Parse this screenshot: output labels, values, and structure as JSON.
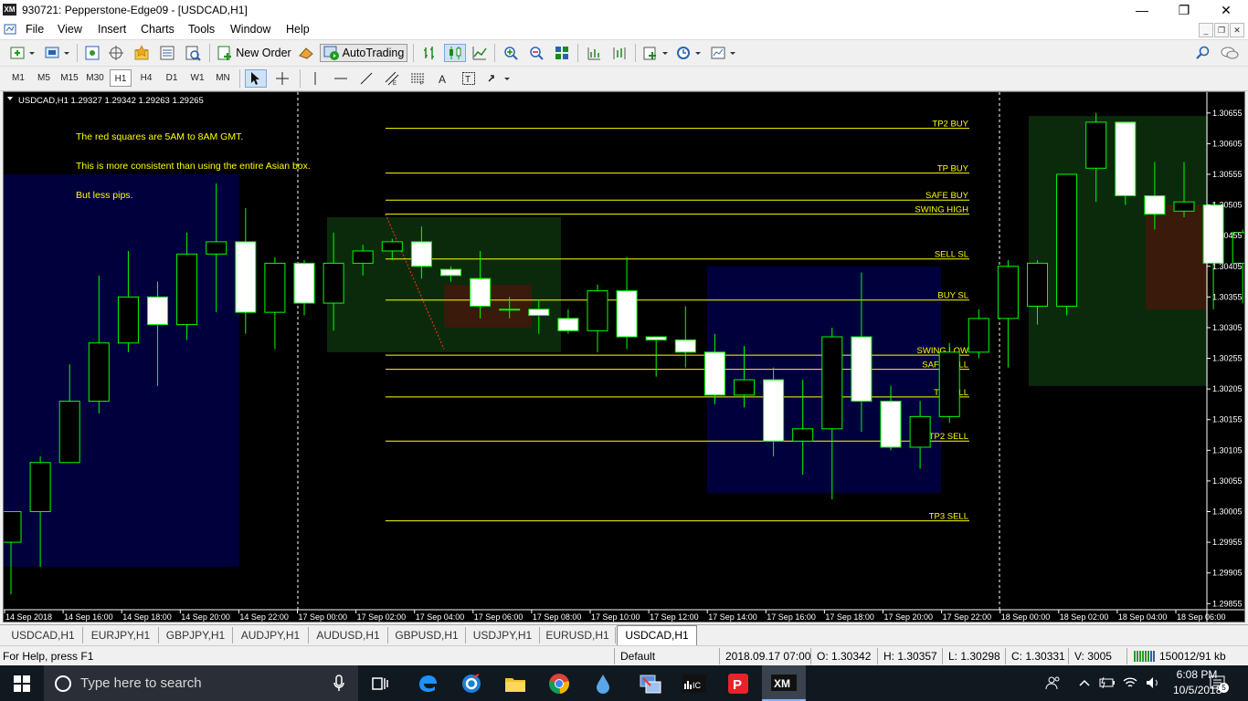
{
  "window": {
    "title": "930721: Pepperstone-Edge09 - [USDCAD,H1]",
    "app_logo": "XM",
    "minimize": "—",
    "maximize": "❐",
    "close": "✕"
  },
  "menu": [
    "File",
    "View",
    "Insert",
    "Charts",
    "Tools",
    "Window",
    "Help"
  ],
  "toolbar": {
    "new_order": "New Order",
    "autotrading": "AutoTrading"
  },
  "timeframes": [
    "M1",
    "M5",
    "M15",
    "M30",
    "H1",
    "H4",
    "D1",
    "W1",
    "MN"
  ],
  "active_timeframe": "H1",
  "chart": {
    "header": "USDCAD,H1  1.29327 1.29342 1.29263 1.29265",
    "annotations": [
      "The red squares are 5AM to 8AM GMT.",
      "This is more consistent than using the entire Asian box.",
      "But less pips."
    ],
    "level_labels": {
      "tp2_buy": "TP2 BUY",
      "tp_buy": "TP BUY",
      "safe_buy": "SAFE BUY",
      "swing_high": "SWING HIGH",
      "sell_sl": "SELL SL",
      "buy_sl": "BUY SL",
      "swing_low": "SWING LOW",
      "safe_sell": "SAFE SELL",
      "tp_sell": "TP SELL",
      "tp2_sell": "TP2 SELL",
      "tp3_sell": "TP3 SELL"
    },
    "price_ticks": [
      "1.30655",
      "1.30605",
      "1.30555",
      "1.30505",
      "1.30455",
      "1.30405",
      "1.30355",
      "1.30305",
      "1.30255",
      "1.30205",
      "1.30155",
      "1.30105",
      "1.30055",
      "1.30005",
      "1.29955",
      "1.29905",
      "1.29855"
    ],
    "time_ticks": [
      "14 Sep 2018",
      "14 Sep 16:00",
      "14 Sep 18:00",
      "14 Sep 20:00",
      "14 Sep 22:00",
      "17 Sep 00:00",
      "17 Sep 02:00",
      "17 Sep 04:00",
      "17 Sep 06:00",
      "17 Sep 08:00",
      "17 Sep 10:00",
      "17 Sep 12:00",
      "17 Sep 14:00",
      "17 Sep 16:00",
      "17 Sep 18:00",
      "17 Sep 20:00",
      "17 Sep 22:00",
      "18 Sep 00:00",
      "18 Sep 02:00",
      "18 Sep 04:00",
      "18 Sep 06:00"
    ],
    "colors": {
      "background": "#000000",
      "bull_body": "#000000",
      "bear_body": "#ffffff",
      "wick": "#00ff00",
      "level_line": "#ffff00",
      "asian_box": "#00003c",
      "green_box": "#0b2a0b",
      "red_box": "#3a1a0a"
    }
  },
  "chart_data": {
    "type": "candlestick",
    "symbol": "USDCAD",
    "timeframe": "H1",
    "ylim": [
      1.29845,
      1.3068
    ],
    "candles": [
      {
        "o": 1.29955,
        "h": 1.30005,
        "l": 1.2987,
        "c": 1.30005
      },
      {
        "o": 1.30005,
        "h": 1.30095,
        "l": 1.29915,
        "c": 1.30085
      },
      {
        "o": 1.30085,
        "h": 1.30245,
        "l": 1.3015,
        "c": 1.30185
      },
      {
        "o": 1.30185,
        "h": 1.3039,
        "l": 1.30165,
        "c": 1.3028
      },
      {
        "o": 1.3028,
        "h": 1.3043,
        "l": 1.30265,
        "c": 1.30355
      },
      {
        "o": 1.30355,
        "h": 1.3038,
        "l": 1.3021,
        "c": 1.3031
      },
      {
        "o": 1.3031,
        "h": 1.3046,
        "l": 1.30285,
        "c": 1.30425
      },
      {
        "o": 1.30425,
        "h": 1.3054,
        "l": 1.3033,
        "c": 1.30445
      },
      {
        "o": 1.30445,
        "h": 1.305,
        "l": 1.30295,
        "c": 1.3033
      },
      {
        "o": 1.3033,
        "h": 1.3042,
        "l": 1.3027,
        "c": 1.3041
      },
      {
        "o": 1.3041,
        "h": 1.30415,
        "l": 1.30325,
        "c": 1.30345
      },
      {
        "o": 1.30345,
        "h": 1.3046,
        "l": 1.303,
        "c": 1.3041
      },
      {
        "o": 1.3041,
        "h": 1.3044,
        "l": 1.3039,
        "c": 1.3043
      },
      {
        "o": 1.3043,
        "h": 1.3045,
        "l": 1.30415,
        "c": 1.30445
      },
      {
        "o": 1.30445,
        "h": 1.3047,
        "l": 1.30385,
        "c": 1.30405
      },
      {
        "o": 1.304,
        "h": 1.30405,
        "l": 1.3038,
        "c": 1.3039
      },
      {
        "o": 1.30385,
        "h": 1.3043,
        "l": 1.3032,
        "c": 1.3034
      },
      {
        "o": 1.30335,
        "h": 1.30355,
        "l": 1.3032,
        "c": 1.30335
      },
      {
        "o": 1.30335,
        "h": 1.3035,
        "l": 1.30295,
        "c": 1.30325
      },
      {
        "o": 1.3032,
        "h": 1.30335,
        "l": 1.30295,
        "c": 1.303
      },
      {
        "o": 1.303,
        "h": 1.30375,
        "l": 1.30265,
        "c": 1.30365
      },
      {
        "o": 1.30365,
        "h": 1.3042,
        "l": 1.3027,
        "c": 1.3029
      },
      {
        "o": 1.3029,
        "h": 1.3029,
        "l": 1.30225,
        "c": 1.30285
      },
      {
        "o": 1.30285,
        "h": 1.3034,
        "l": 1.3024,
        "c": 1.30265
      },
      {
        "o": 1.30265,
        "h": 1.30295,
        "l": 1.3018,
        "c": 1.30195
      },
      {
        "o": 1.30195,
        "h": 1.30275,
        "l": 1.30175,
        "c": 1.3022
      },
      {
        "o": 1.3022,
        "h": 1.3024,
        "l": 1.30095,
        "c": 1.3012
      },
      {
        "o": 1.3012,
        "h": 1.3022,
        "l": 1.30065,
        "c": 1.3014
      },
      {
        "o": 1.3014,
        "h": 1.30305,
        "l": 1.30025,
        "c": 1.3029
      },
      {
        "o": 1.3029,
        "h": 1.30395,
        "l": 1.30135,
        "c": 1.30185
      },
      {
        "o": 1.30185,
        "h": 1.3021,
        "l": 1.30105,
        "c": 1.3011
      },
      {
        "o": 1.3011,
        "h": 1.30185,
        "l": 1.30075,
        "c": 1.3016
      },
      {
        "o": 1.3016,
        "h": 1.3028,
        "l": 1.3015,
        "c": 1.30265
      },
      {
        "o": 1.30265,
        "h": 1.30335,
        "l": 1.30255,
        "c": 1.3032
      },
      {
        "o": 1.3032,
        "h": 1.30415,
        "l": 1.3024,
        "c": 1.30405
      },
      {
        "o": 1.3034,
        "h": 1.30415,
        "l": 1.3031,
        "c": 1.3041
      },
      {
        "o": 1.3034,
        "h": 1.30555,
        "l": 1.30325,
        "c": 1.30555
      },
      {
        "o": 1.30565,
        "h": 1.30655,
        "l": 1.3051,
        "c": 1.3064
      },
      {
        "o": 1.3064,
        "h": 1.3064,
        "l": 1.30505,
        "c": 1.3052
      },
      {
        "o": 1.3052,
        "h": 1.30575,
        "l": 1.30465,
        "c": 1.3049
      },
      {
        "o": 1.30495,
        "h": 1.30575,
        "l": 1.30485,
        "c": 1.3051
      },
      {
        "o": 1.30505,
        "h": 1.3051,
        "l": 1.30335,
        "c": 1.3041
      },
      {
        "o": 1.3041,
        "h": 1.30465,
        "l": 1.30345,
        "c": 1.3046
      }
    ],
    "levels": [
      {
        "name": "TP2 BUY",
        "price": 1.3063
      },
      {
        "name": "TP BUY",
        "price": 1.30557
      },
      {
        "name": "SAFE BUY",
        "price": 1.30513
      },
      {
        "name": "SWING HIGH",
        "price": 1.3049
      },
      {
        "name": "SELL SL",
        "price": 1.30417
      },
      {
        "name": "BUY SL",
        "price": 1.3035
      },
      {
        "name": "SWING LOW",
        "price": 1.3026
      },
      {
        "name": "SAFE SELL",
        "price": 1.30237
      },
      {
        "name": "TP SELL",
        "price": 1.30192
      },
      {
        "name": "TP2 SELL",
        "price": 1.3012
      },
      {
        "name": "TP3 SELL",
        "price": 1.2999
      }
    ]
  },
  "chart_tabs": [
    "USDCAD,H1",
    "EURJPY,H1",
    "GBPJPY,H1",
    "AUDJPY,H1",
    "AUDUSD,H1",
    "GBPUSD,H1",
    "USDJPY,H1",
    "EURUSD,H1",
    "USDCAD,H1"
  ],
  "active_chart_tab": 8,
  "status": {
    "help": "For Help, press F1",
    "profile": "Default",
    "datetime": "2018.09.17 07:00",
    "open": "O: 1.30342",
    "high": "H: 1.30357",
    "low": "L: 1.30298",
    "close": "C: 1.30331",
    "volume": "V: 3005",
    "traffic": "150012/91 kb"
  },
  "taskbar": {
    "search_placeholder": "Type here to search",
    "time": "6:08 PM",
    "date": "10/5/2018",
    "notifications": "5"
  }
}
